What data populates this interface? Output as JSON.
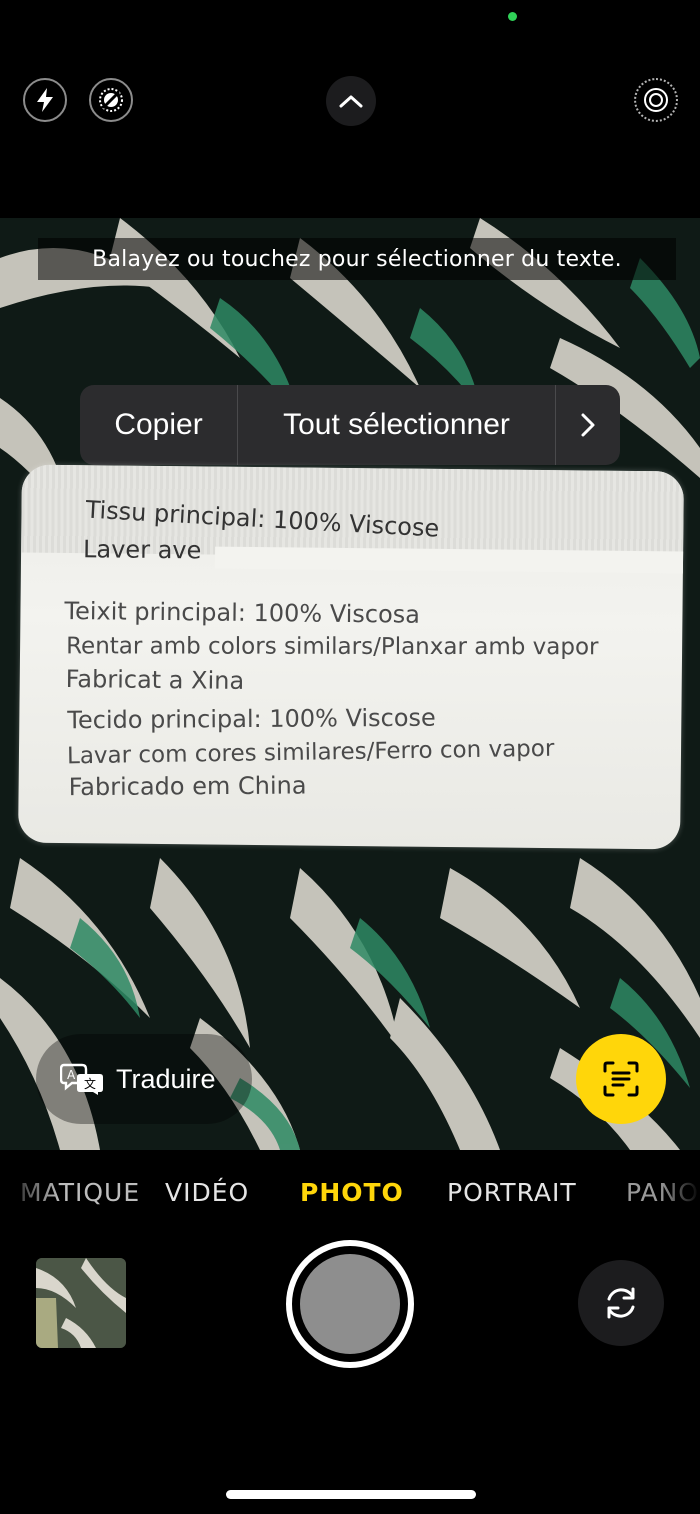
{
  "top_bar": {
    "flash_icon": "bolt-icon",
    "live_photo_icon": "live-photo-icon",
    "expand_icon": "chevron-up-icon",
    "settings_icon": "live-target-icon"
  },
  "viewfinder": {
    "hint": "Balayez ou touchez pour sélectionner du texte.",
    "callout": {
      "copy": "Copier",
      "select_all": "Tout sélectionner",
      "more": "›"
    },
    "label_lines": [
      "Tissu principal: 100% Viscose",
      "Laver ave",
      "Teixit principal: 100% Viscosa",
      "Rentar amb colors similars/Planxar amb vapor",
      "Fabricat a Xina",
      "Tecido principal: 100% Viscose",
      "Lavar com cores similares/Ferro con vapor",
      "Fabricado em China"
    ],
    "translate_label": "Traduire",
    "live_text_icon": "live-text-icon"
  },
  "modes": {
    "cinematic": "MATIQUE",
    "video": "VIDÉO",
    "photo": "PHOTO",
    "portrait": "PORTRAIT",
    "pano": "PANO"
  },
  "colors": {
    "accent": "#ffd60a",
    "indicator": "#30d158"
  }
}
